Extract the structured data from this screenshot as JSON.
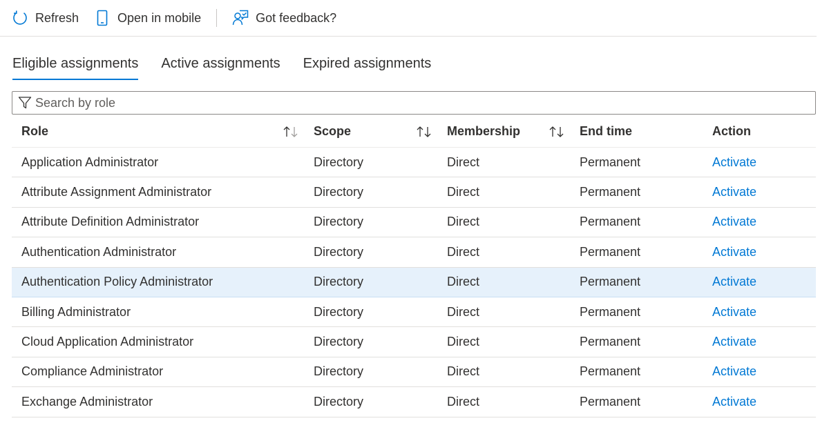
{
  "toolbar": {
    "refresh_label": "Refresh",
    "open_mobile_label": "Open in mobile",
    "feedback_label": "Got feedback?"
  },
  "tabs": [
    {
      "label": "Eligible assignments",
      "active": true
    },
    {
      "label": "Active assignments",
      "active": false
    },
    {
      "label": "Expired assignments",
      "active": false
    }
  ],
  "search": {
    "placeholder": "Search by role",
    "value": ""
  },
  "table": {
    "columns": [
      "Role",
      "Scope",
      "Membership",
      "End time",
      "Action"
    ],
    "rows": [
      {
        "role": "Application Administrator",
        "scope": "Directory",
        "membership": "Direct",
        "end_time": "Permanent",
        "action": "Activate"
      },
      {
        "role": "Attribute Assignment Administrator",
        "scope": "Directory",
        "membership": "Direct",
        "end_time": "Permanent",
        "action": "Activate"
      },
      {
        "role": "Attribute Definition Administrator",
        "scope": "Directory",
        "membership": "Direct",
        "end_time": "Permanent",
        "action": "Activate"
      },
      {
        "role": "Authentication Administrator",
        "scope": "Directory",
        "membership": "Direct",
        "end_time": "Permanent",
        "action": "Activate"
      },
      {
        "role": "Authentication Policy Administrator",
        "scope": "Directory",
        "membership": "Direct",
        "end_time": "Permanent",
        "action": "Activate",
        "selected": true
      },
      {
        "role": "Billing Administrator",
        "scope": "Directory",
        "membership": "Direct",
        "end_time": "Permanent",
        "action": "Activate"
      },
      {
        "role": "Cloud Application Administrator",
        "scope": "Directory",
        "membership": "Direct",
        "end_time": "Permanent",
        "action": "Activate"
      },
      {
        "role": "Compliance Administrator",
        "scope": "Directory",
        "membership": "Direct",
        "end_time": "Permanent",
        "action": "Activate"
      },
      {
        "role": "Exchange Administrator",
        "scope": "Directory",
        "membership": "Direct",
        "end_time": "Permanent",
        "action": "Activate"
      }
    ]
  },
  "colors": {
    "accent": "#0078d4",
    "selected_row": "#e6f1fb",
    "text": "#323130"
  },
  "icons": {
    "refresh": "refresh-icon",
    "mobile": "mobile-icon",
    "feedback": "feedback-icon",
    "filter": "filter-icon",
    "sort": "sort-icon"
  }
}
